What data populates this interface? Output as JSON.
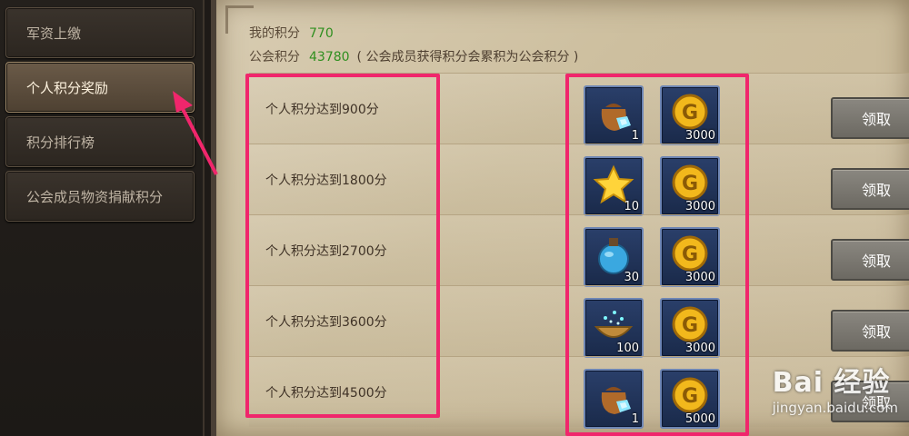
{
  "sidebar": {
    "items": [
      {
        "label": "军资上缴",
        "active": false
      },
      {
        "label": "个人积分奖励",
        "active": true
      },
      {
        "label": "积分排行榜",
        "active": false
      },
      {
        "label": "公会成员物资捐献积分",
        "active": false
      }
    ]
  },
  "scores": {
    "mine_label": "我的积分",
    "mine_value": "770",
    "guild_label": "公会积分",
    "guild_value": "43780",
    "guild_note": "( 公会成员获得积分会累积为公会积分 )"
  },
  "rewards": [
    {
      "label": "个人积分达到900分",
      "items": [
        {
          "icon": "pouch-gems-icon",
          "count": "1"
        },
        {
          "icon": "gold-coin-icon",
          "count": "3000"
        }
      ],
      "button": "领取"
    },
    {
      "label": "个人积分达到1800分",
      "items": [
        {
          "icon": "star-icon",
          "count": "10"
        },
        {
          "icon": "gold-coin-icon",
          "count": "3000"
        }
      ],
      "button": "领取"
    },
    {
      "label": "个人积分达到2700分",
      "items": [
        {
          "icon": "potion-flask-icon",
          "count": "30"
        },
        {
          "icon": "gold-coin-icon",
          "count": "3000"
        }
      ],
      "button": "领取"
    },
    {
      "label": "个人积分达到3600分",
      "items": [
        {
          "icon": "magic-bowl-icon",
          "count": "100"
        },
        {
          "icon": "gold-coin-icon",
          "count": "3000"
        }
      ],
      "button": "领取"
    },
    {
      "label": "个人积分达到4500分",
      "items": [
        {
          "icon": "pouch-gems-icon",
          "count": "1"
        },
        {
          "icon": "gold-coin-icon",
          "count": "5000"
        }
      ],
      "button": "领取"
    }
  ],
  "watermark": {
    "brand": "Bai 经验",
    "site": "jingyan.baidu.com"
  },
  "colors": {
    "highlight": "#f0266c",
    "score_green": "#2f8f1f"
  }
}
